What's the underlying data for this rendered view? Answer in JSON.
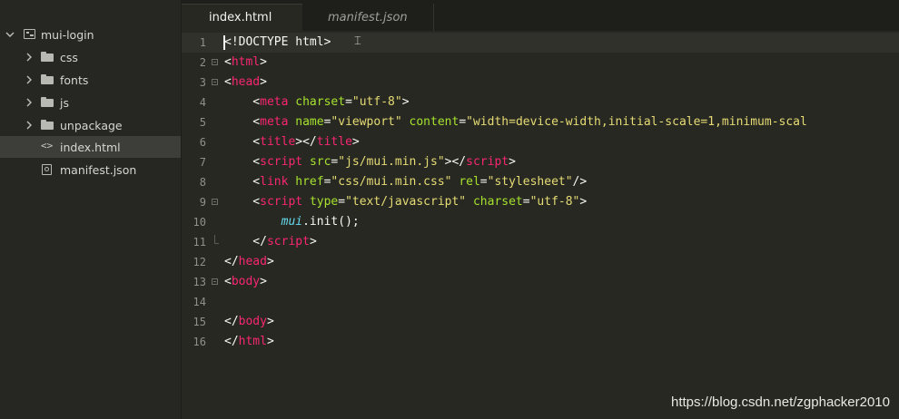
{
  "sidebar": {
    "project": {
      "label": "mui-login",
      "icon": "project-icon",
      "expanded": true
    },
    "items": [
      {
        "label": "css",
        "type": "folder",
        "icon": "folder-icon"
      },
      {
        "label": "fonts",
        "type": "folder",
        "icon": "folder-icon"
      },
      {
        "label": "js",
        "type": "folder",
        "icon": "folder-icon"
      },
      {
        "label": "unpackage",
        "type": "folder",
        "icon": "folder-icon"
      },
      {
        "label": "index.html",
        "type": "file",
        "icon": "code-file-icon",
        "selected": true
      },
      {
        "label": "manifest.json",
        "type": "file",
        "icon": "config-file-icon"
      }
    ]
  },
  "tabs": [
    {
      "label": "index.html",
      "active": true
    },
    {
      "label": "manifest.json",
      "active": false
    }
  ],
  "editor": {
    "current_line": 1,
    "lines": [
      {
        "n": "1",
        "tokens": [
          [
            "plain",
            "<!DOCTYPE html>"
          ]
        ]
      },
      {
        "n": "2",
        "tokens": [
          [
            "plain",
            "<"
          ],
          [
            "tag",
            "html"
          ],
          [
            "plain",
            ">"
          ]
        ]
      },
      {
        "n": "3",
        "tokens": [
          [
            "plain",
            "<"
          ],
          [
            "tag",
            "head"
          ],
          [
            "plain",
            ">"
          ]
        ]
      },
      {
        "n": "4",
        "tokens": [
          [
            "plain",
            "    <"
          ],
          [
            "tag",
            "meta"
          ],
          [
            "plain",
            " "
          ],
          [
            "attr",
            "charset"
          ],
          [
            "plain",
            "="
          ],
          [
            "str",
            "\"utf-8\""
          ],
          [
            "plain",
            ">"
          ]
        ]
      },
      {
        "n": "5",
        "tokens": [
          [
            "plain",
            "    <"
          ],
          [
            "tag",
            "meta"
          ],
          [
            "plain",
            " "
          ],
          [
            "attr",
            "name"
          ],
          [
            "plain",
            "="
          ],
          [
            "str",
            "\"viewport\""
          ],
          [
            "plain",
            " "
          ],
          [
            "attr",
            "content"
          ],
          [
            "plain",
            "="
          ],
          [
            "str",
            "\"width=device-width,initial-scale=1,minimum-scal"
          ]
        ]
      },
      {
        "n": "6",
        "tokens": [
          [
            "plain",
            "    <"
          ],
          [
            "tag",
            "title"
          ],
          [
            "plain",
            "></"
          ],
          [
            "tag",
            "title"
          ],
          [
            "plain",
            ">"
          ]
        ]
      },
      {
        "n": "7",
        "tokens": [
          [
            "plain",
            "    <"
          ],
          [
            "tag",
            "script"
          ],
          [
            "plain",
            " "
          ],
          [
            "attr",
            "src"
          ],
          [
            "plain",
            "="
          ],
          [
            "str",
            "\"js/mui.min.js\""
          ],
          [
            "plain",
            "></"
          ],
          [
            "tag",
            "script"
          ],
          [
            "plain",
            ">"
          ]
        ]
      },
      {
        "n": "8",
        "tokens": [
          [
            "plain",
            "    <"
          ],
          [
            "tag",
            "link"
          ],
          [
            "plain",
            " "
          ],
          [
            "attr",
            "href"
          ],
          [
            "plain",
            "="
          ],
          [
            "str",
            "\"css/mui.min.css\""
          ],
          [
            "plain",
            " "
          ],
          [
            "attr",
            "rel"
          ],
          [
            "plain",
            "="
          ],
          [
            "str",
            "\"stylesheet\""
          ],
          [
            "plain",
            "/>"
          ]
        ]
      },
      {
        "n": "9",
        "tokens": [
          [
            "plain",
            "    <"
          ],
          [
            "tag",
            "script"
          ],
          [
            "plain",
            " "
          ],
          [
            "attr",
            "type"
          ],
          [
            "plain",
            "="
          ],
          [
            "str",
            "\"text/javascript\""
          ],
          [
            "plain",
            " "
          ],
          [
            "attr",
            "charset"
          ],
          [
            "plain",
            "="
          ],
          [
            "str",
            "\"utf-8\""
          ],
          [
            "plain",
            ">"
          ]
        ]
      },
      {
        "n": "10",
        "tokens": [
          [
            "plain",
            "        "
          ],
          [
            "ident",
            "mui"
          ],
          [
            "plain",
            ".init();"
          ]
        ]
      },
      {
        "n": "11",
        "tokens": [
          [
            "plain",
            "    </"
          ],
          [
            "tag",
            "script"
          ],
          [
            "plain",
            ">"
          ]
        ]
      },
      {
        "n": "12",
        "tokens": [
          [
            "plain",
            "</"
          ],
          [
            "tag",
            "head"
          ],
          [
            "plain",
            ">"
          ]
        ]
      },
      {
        "n": "13",
        "tokens": [
          [
            "plain",
            "<"
          ],
          [
            "tag",
            "body"
          ],
          [
            "plain",
            ">"
          ]
        ]
      },
      {
        "n": "14",
        "tokens": []
      },
      {
        "n": "15",
        "tokens": [
          [
            "plain",
            "</"
          ],
          [
            "tag",
            "body"
          ],
          [
            "plain",
            ">"
          ]
        ]
      },
      {
        "n": "16",
        "tokens": [
          [
            "plain",
            "</"
          ],
          [
            "tag",
            "html"
          ],
          [
            "plain",
            ">"
          ]
        ]
      }
    ]
  },
  "watermark": "https://blog.csdn.net/zgphacker2010",
  "colors": {
    "background": "#272822",
    "tag": "#f92672",
    "attribute": "#a6e22e",
    "string": "#e6db74",
    "identifier": "#66d9ef"
  }
}
